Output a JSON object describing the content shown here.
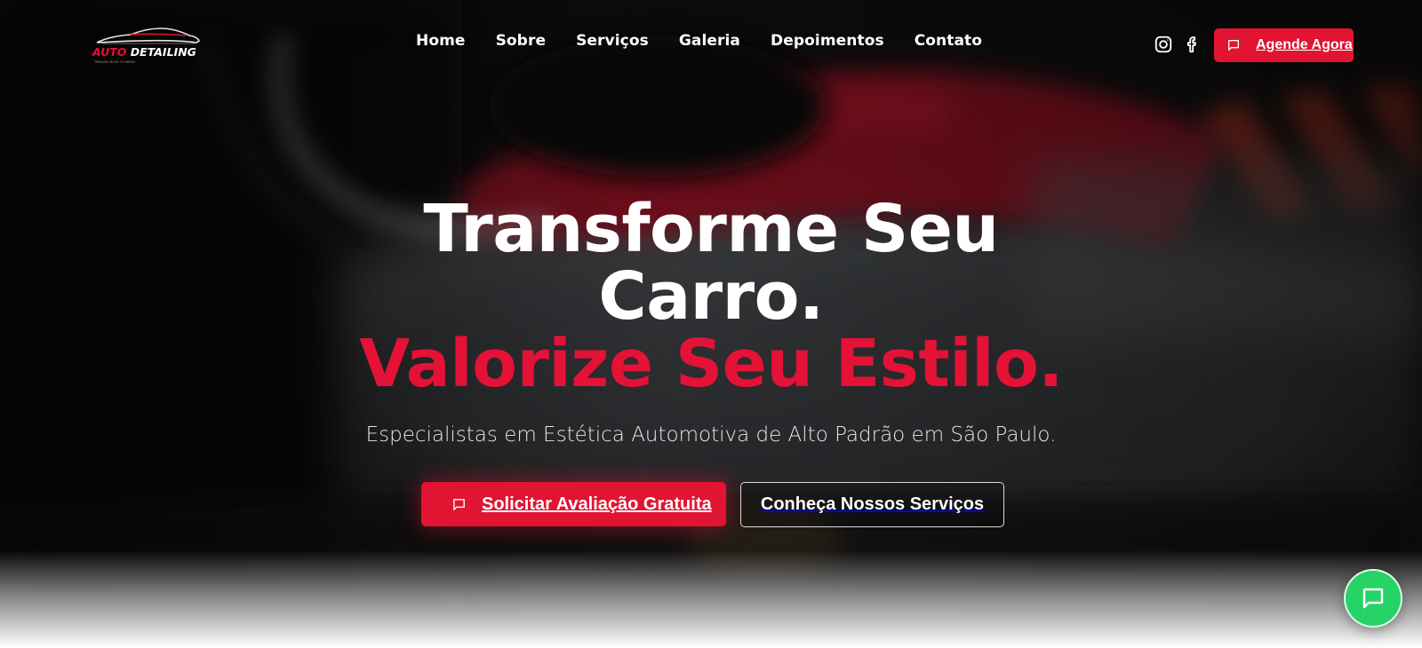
{
  "brand": {
    "logo_text": "AUTO DETAILING",
    "logo_tagline": "TRAILING BODY TO MEMO",
    "accent_color": "#e11432",
    "whatsapp_color": "#25d366"
  },
  "nav": {
    "items": [
      "Home",
      "Sobre",
      "Serviços",
      "Galeria",
      "Depoimentos",
      "Contato"
    ]
  },
  "header": {
    "social_icons": [
      "instagram-icon",
      "facebook-icon"
    ],
    "cta_label": "Agende Agora",
    "cta_icon": "chat-bubble-icon"
  },
  "hero": {
    "headline_line1": "Transforme Seu",
    "headline_line2": "Carro.",
    "headline_line3": "Valorize Seu Estilo.",
    "subtitle": "Especialistas em Estética Automotiva de Alto Padrão em São Paulo.",
    "primary_button": "Solicitar Avaliação Gratuita",
    "secondary_button": "Conheça Nossos Serviços"
  },
  "floating_chat": {
    "icon": "chat-bubble-icon"
  }
}
